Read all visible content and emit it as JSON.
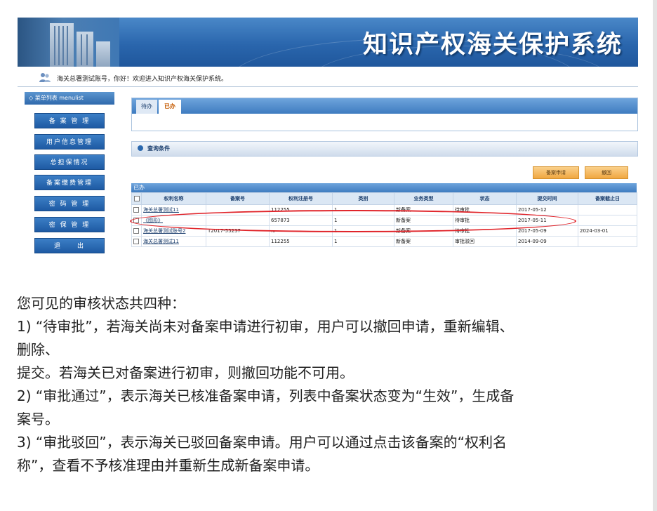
{
  "banner": {
    "title": "知识产权海关保护系统"
  },
  "welcome": {
    "text": "海关总署测试账号，你好！欢迎进入知识产权海关保护系统。"
  },
  "sidebar": {
    "header": "◇ 菜单列表 menulist",
    "items": [
      "备 案 管 理",
      "用户信息管理",
      "总担保情况",
      "备案缴费管理",
      "密 码 管 理",
      "密 保 管 理",
      "退　　出"
    ]
  },
  "tabs": [
    "待办",
    "已办"
  ],
  "query": {
    "label": "查询条件",
    "apply_label": "备案申请",
    "withdraw_label": "撤回"
  },
  "grid": {
    "title": "已办",
    "columns": [
      "权利名称",
      "备案号",
      "权利注册号",
      "类别",
      "业务类型",
      "状态",
      "提交时间",
      "备案截止日"
    ],
    "rows": [
      [
        "海关总署测试11",
        "",
        "112255",
        "1",
        "新备案",
        "待审批",
        "2017-05-12",
        ""
      ],
      [
        "《图形》",
        "",
        "657873",
        "1",
        "新备案",
        "待审批",
        "2017-05-11",
        ""
      ],
      [
        "海关总署测试账号2",
        "T2017-55237",
        "...",
        "1",
        "新备案",
        "待审批",
        "2017-05-09",
        "2024-03-01"
      ],
      [
        "海关总署测试11",
        "",
        "112255",
        "1",
        "新备案",
        "审批驳回",
        "2014-09-09",
        ""
      ]
    ]
  },
  "doc": {
    "lines": [
      "您可见的审核状态共四种：",
      "1) “待审批”，若海关尚未对备案申请进行初审，用户可以撤回申请，重新编辑、",
      "删除、",
      "提交。若海关已对备案进行初审，则撤回功能不可用。",
      "2) “审批通过”，表示海关已核准备案申请，列表中备案状态变为“生效”，生成备",
      "案号。",
      "3) “审批驳回”，表示海关已驳回备案申请。用户可以通过点击该备案的“权利名",
      "称”，查看不予核准理由并重新生成新备案申请。"
    ]
  },
  "colors": {
    "banner_blue": "#2a66ad",
    "highlight_red": "#e0242a",
    "button_orange": "#f0a741"
  }
}
